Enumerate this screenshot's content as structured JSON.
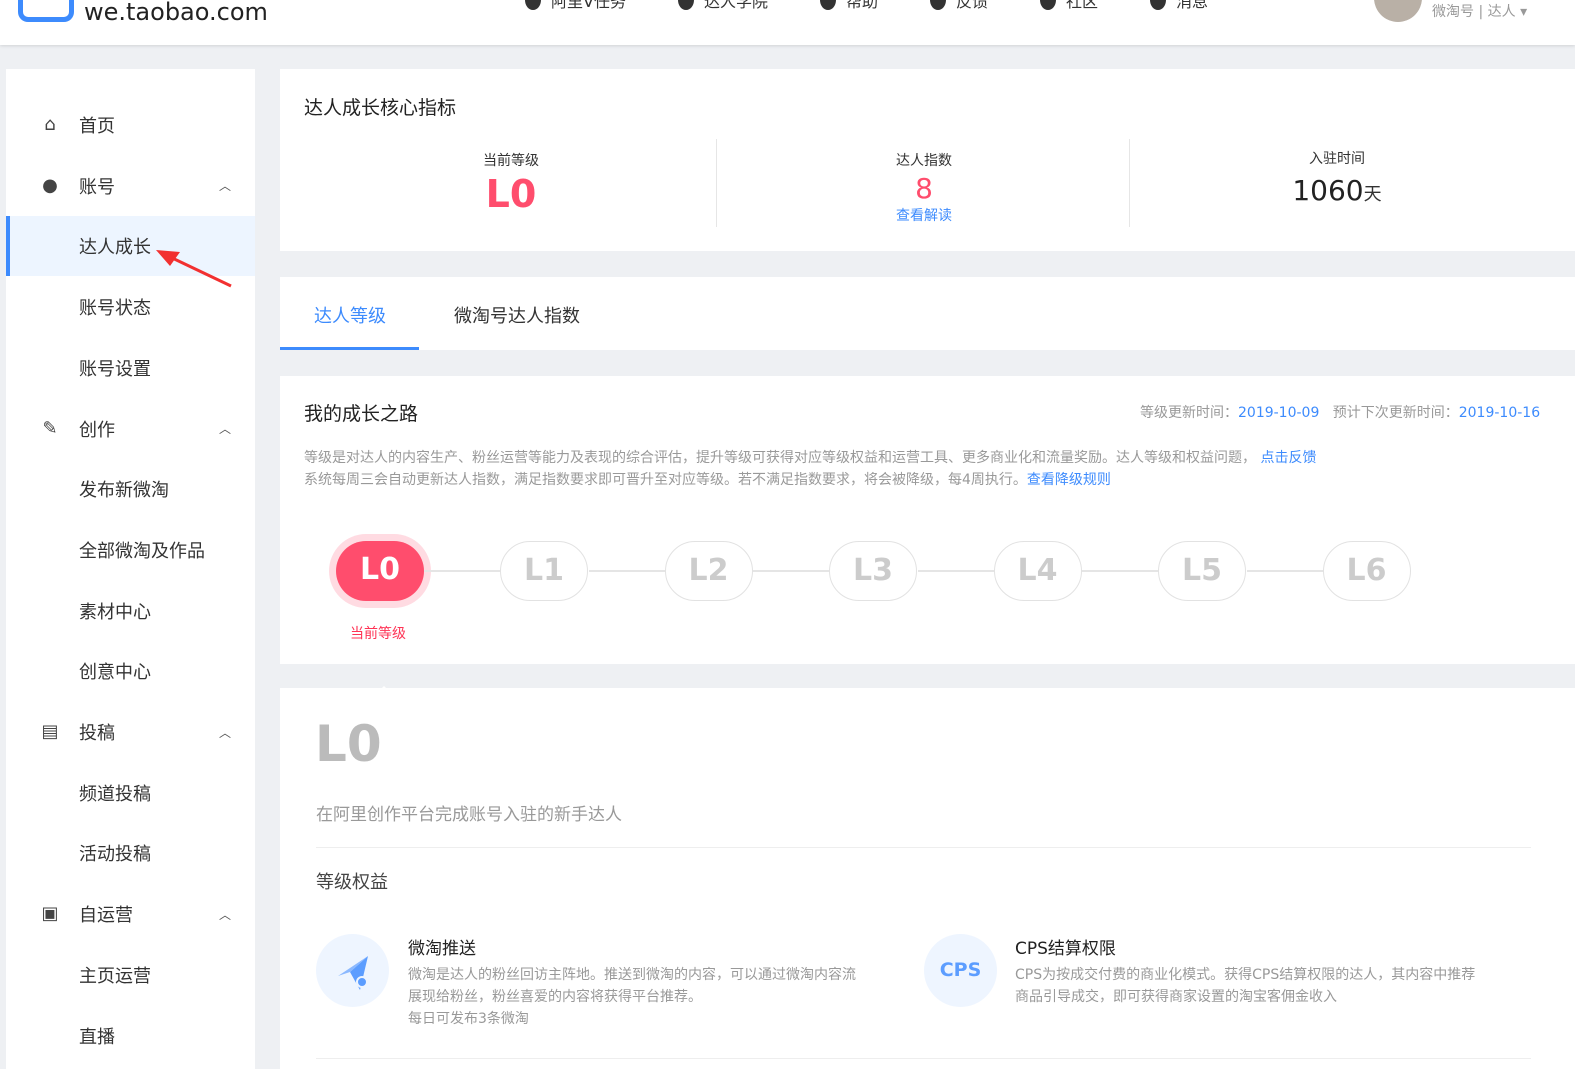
{
  "header": {
    "site": "we.taobao.com",
    "nav": [
      {
        "label": "阿里V任务",
        "icon": "task-icon"
      },
      {
        "label": "达人学院",
        "icon": "school-icon"
      },
      {
        "label": "帮助",
        "icon": "help-icon"
      },
      {
        "label": "反馈",
        "icon": "feedback-icon"
      },
      {
        "label": "社区",
        "icon": "community-icon"
      },
      {
        "label": "消息",
        "icon": "message-icon"
      }
    ],
    "user": "微淘号 | 达人 ▾"
  },
  "sidebar": {
    "items": [
      {
        "label": "首页",
        "icon": "home-icon"
      },
      {
        "label": "账号",
        "icon": "user-icon",
        "chev": "^"
      },
      {
        "label": "达人成长",
        "active": true
      },
      {
        "label": "账号状态"
      },
      {
        "label": "账号设置"
      },
      {
        "label": "创作",
        "icon": "pencil-icon",
        "chev": "^"
      },
      {
        "label": "发布新微淘"
      },
      {
        "label": "全部微淘及作品"
      },
      {
        "label": "素材中心"
      },
      {
        "label": "创意中心"
      },
      {
        "label": "投稿",
        "icon": "document-icon",
        "chev": "^"
      },
      {
        "label": "频道投稿"
      },
      {
        "label": "活动投稿"
      },
      {
        "label": "自运营",
        "icon": "box-icon",
        "chev": "^"
      },
      {
        "label": "主页运营"
      },
      {
        "label": "直播"
      }
    ]
  },
  "core": {
    "title": "达人成长核心指标",
    "level_label": "当前等级",
    "level": "L0",
    "index_label": "达人指数",
    "index": "8",
    "index_link": "查看解读",
    "join_label": "入驻时间",
    "join_days": "1060",
    "join_unit": "天"
  },
  "tabs": [
    {
      "label": "达人等级",
      "active": true
    },
    {
      "label": "微淘号达人指数"
    }
  ],
  "growth": {
    "title": "我的成长之路",
    "update_label": "等级更新时间：",
    "update": "2019-10-09",
    "next_label": "预计下次更新时间：",
    "next": "2019-10-16",
    "desc1": "等级是对达人的内容生产、粉丝运营等能力及表现的综合评估，提升等级可获得对应等级权益和运营工具、更多商业化和流量奖励。达人等级和权益问题，",
    "desc1_link": "点击反馈",
    "desc2": "系统每周三会自动更新达人指数，满足指数要求即可晋升至对应等级。若不满足指数要求，将会被降级，每4周执行。",
    "desc2_link": "查看降级规则",
    "levels": [
      "L0",
      "L1",
      "L2",
      "L3",
      "L4",
      "L5",
      "L6"
    ],
    "current_label": "当前等级",
    "accent": "#ff4d6d"
  },
  "detail": {
    "level": "L0",
    "desc": "在阿里创作平台完成账号入驻的新手达人",
    "benefits_title": "等级权益",
    "benefits": [
      {
        "icon": "paper-plane-icon",
        "title": "微淘推送",
        "lines": [
          "微淘是达人的粉丝回访主阵地。推送到微淘的内容，可以通过微淘内容流",
          "展现给粉丝，粉丝喜爱的内容将获得平台推荐。",
          "每日可发布3条微淘"
        ]
      },
      {
        "icon_text": "CPS",
        "title": "CPS结算权限",
        "lines": [
          "CPS为按成交付费的商业化模式。获得CPS结算权限的达人，其内容中推荐",
          "商品引导成交，即可获得商家设置的淘宝客佣金收入"
        ]
      }
    ]
  }
}
